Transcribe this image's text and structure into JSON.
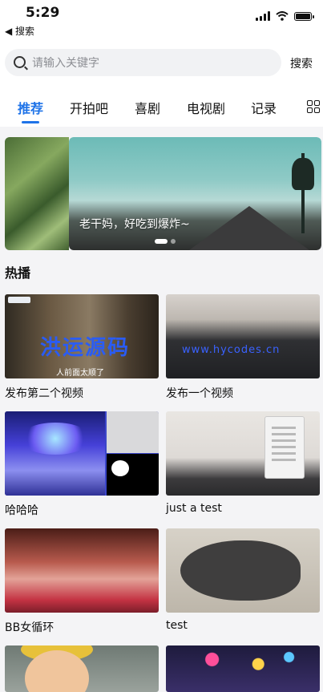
{
  "status_bar": {
    "time": "5:29",
    "back_label": "◀ 搜索"
  },
  "search": {
    "placeholder": "请输入关键字",
    "value": "",
    "button_label": "搜索"
  },
  "tabs": [
    {
      "label": "推荐",
      "active": true
    },
    {
      "label": "开拍吧",
      "active": false
    },
    {
      "label": "喜剧",
      "active": false
    },
    {
      "label": "电视剧",
      "active": false
    },
    {
      "label": "记录",
      "active": false
    }
  ],
  "banner": {
    "caption": "老干妈，好吃到爆炸~",
    "slide_count": 2,
    "active_slide": 1
  },
  "section": {
    "title": "热播"
  },
  "thumb_text": {
    "video1_watermark": "洪运源码",
    "video1_subtitle": "人前面太顺了",
    "video2_watermark": "www.hycodes.cn"
  },
  "videos": [
    {
      "title": "发布第二个视频"
    },
    {
      "title": "发布一个视频"
    },
    {
      "title": "哈哈哈"
    },
    {
      "title": "just a test"
    },
    {
      "title": "BB女循环"
    },
    {
      "title": "test"
    }
  ],
  "colors": {
    "accent": "#1e73e8",
    "background": "#f4f4f6"
  }
}
